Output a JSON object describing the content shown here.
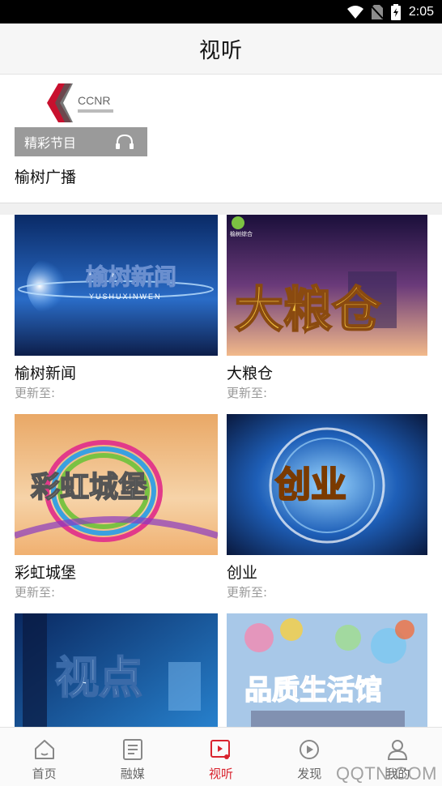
{
  "status_bar": {
    "time": "2:05"
  },
  "header": {
    "title": "视听"
  },
  "radio": {
    "logo_text": "CCNR",
    "overlay_label": "精彩节目",
    "name": "榆树广播"
  },
  "programs": [
    {
      "title": "榆树新闻",
      "update": "更新至:",
      "thumb_text": "榆树新闻",
      "thumb_sub": "YUSHUXINWEN"
    },
    {
      "title": "大粮仓",
      "update": "更新至:",
      "thumb_text": "大粮仓",
      "thumb_sub": "榆树综合"
    },
    {
      "title": "彩虹城堡",
      "update": "更新至:",
      "thumb_text": "彩虹城堡",
      "thumb_sub": ""
    },
    {
      "title": "创业",
      "update": "更新至:",
      "thumb_text": "创业",
      "thumb_sub": ""
    },
    {
      "title": "",
      "update": "",
      "thumb_text": "视点",
      "thumb_sub": ""
    },
    {
      "title": "",
      "update": "",
      "thumb_text": "品质生活馆",
      "thumb_sub": ""
    }
  ],
  "tabs": [
    {
      "label": "首页",
      "icon": "home-icon"
    },
    {
      "label": "融媒",
      "icon": "media-icon"
    },
    {
      "label": "视听",
      "icon": "video-music-icon",
      "active": true
    },
    {
      "label": "发现",
      "icon": "discover-icon"
    },
    {
      "label": "我的",
      "icon": "user-icon"
    }
  ],
  "watermark": "QQTN.COM",
  "colors": {
    "accent": "#d9232e",
    "statusbar": "#000000",
    "overlay": "#9a9a9a"
  }
}
